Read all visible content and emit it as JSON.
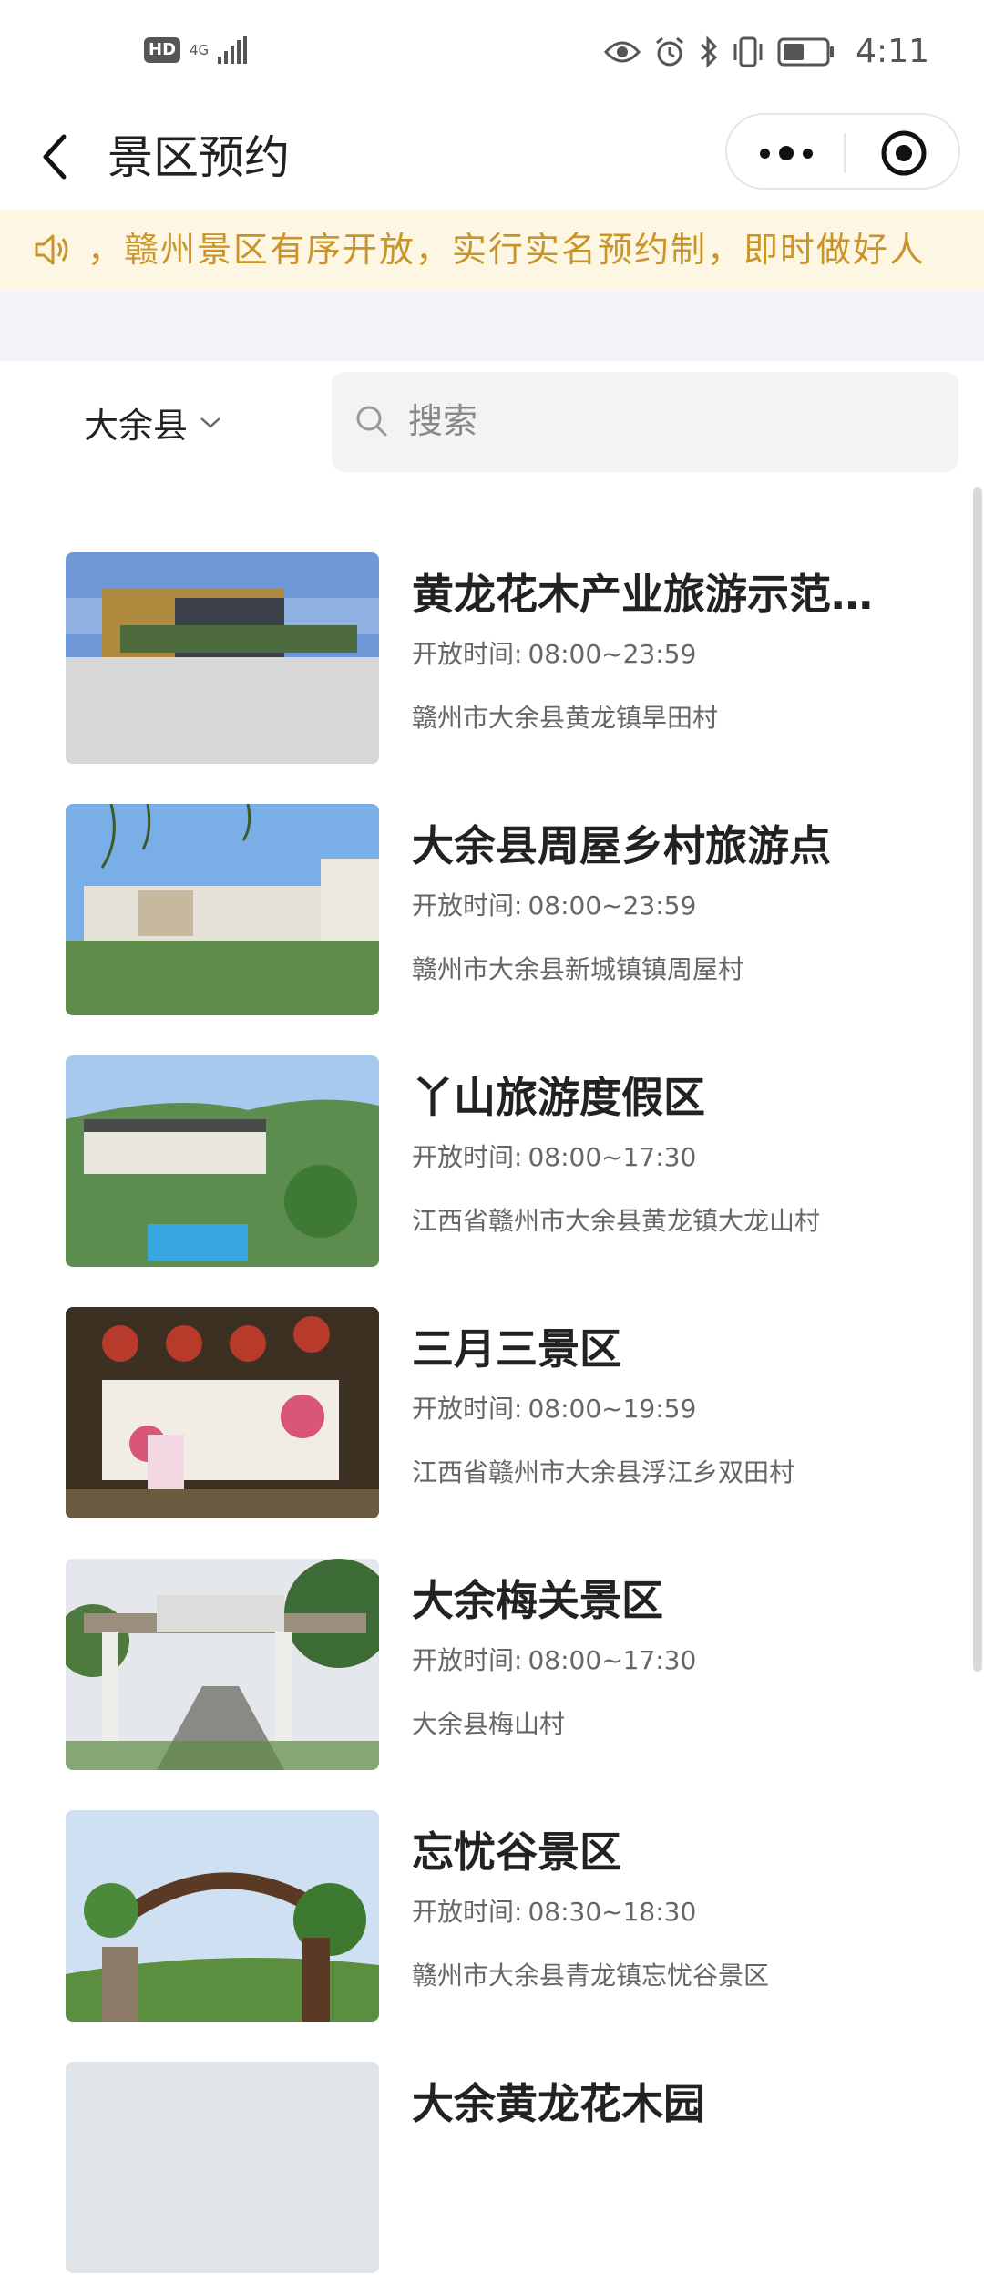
{
  "status_bar": {
    "hd": "HD",
    "network": "4G",
    "time": "4:11"
  },
  "nav": {
    "title": "景区预约"
  },
  "notice": {
    "text": "，赣州景区有序开放，实行实名预约制，即时做好人"
  },
  "filter": {
    "region": "大余县",
    "search_placeholder": "搜索"
  },
  "hours_label": "开放时间:",
  "items": [
    {
      "title": "黄龙花木产业旅游示范基地",
      "hours": "08:00~23:59",
      "address": "赣州市大余县黄龙镇旱田村"
    },
    {
      "title": "大余县周屋乡村旅游点",
      "hours": "08:00~23:59",
      "address": "赣州市大余县新城镇镇周屋村"
    },
    {
      "title": "丫山旅游度假区",
      "hours": "08:00~17:30",
      "address": "江西省赣州市大余县黄龙镇大龙山村"
    },
    {
      "title": "三月三景区",
      "hours": "08:00~19:59",
      "address": "江西省赣州市大余县浮江乡双田村"
    },
    {
      "title": "大余梅关景区",
      "hours": "08:00~17:30",
      "address": "大余县梅山村"
    },
    {
      "title": "忘忧谷景区",
      "hours": "08:30~18:30",
      "address": "赣州市大余县青龙镇忘忧谷景区"
    },
    {
      "title": "大余黄龙花木园",
      "hours": "",
      "address": ""
    }
  ],
  "colors": {
    "notice_bg": "#fdf6e3",
    "notice_text": "#c9952b",
    "band": "#f4f5f9"
  }
}
